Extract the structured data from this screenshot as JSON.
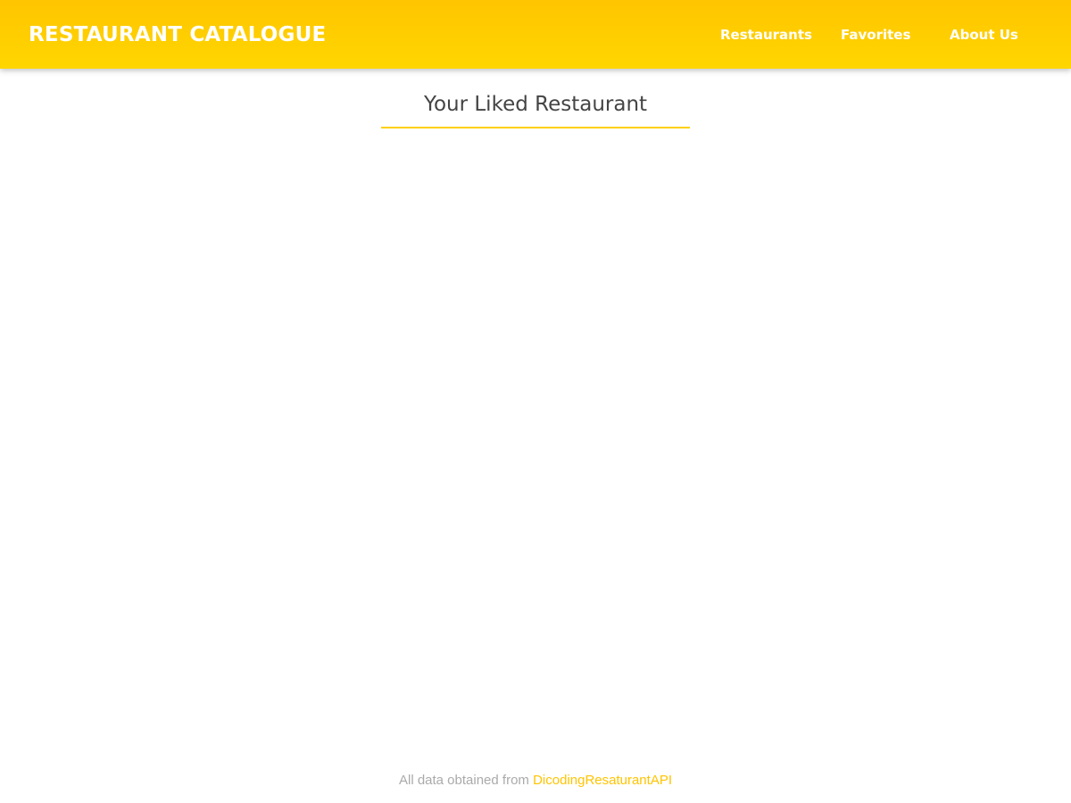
{
  "header": {
    "brand": "RESTAURANT CATALOGUE",
    "nav": [
      "Restaurants",
      "Favorites",
      "About Us"
    ]
  },
  "main": {
    "title": "Your Liked Restaurant"
  },
  "footer": {
    "text": "All data obtained from ",
    "link": "DicodingResaturantAPI"
  },
  "colors": {
    "accent": "#ffd000",
    "footer_text": "#aaaaaa"
  }
}
